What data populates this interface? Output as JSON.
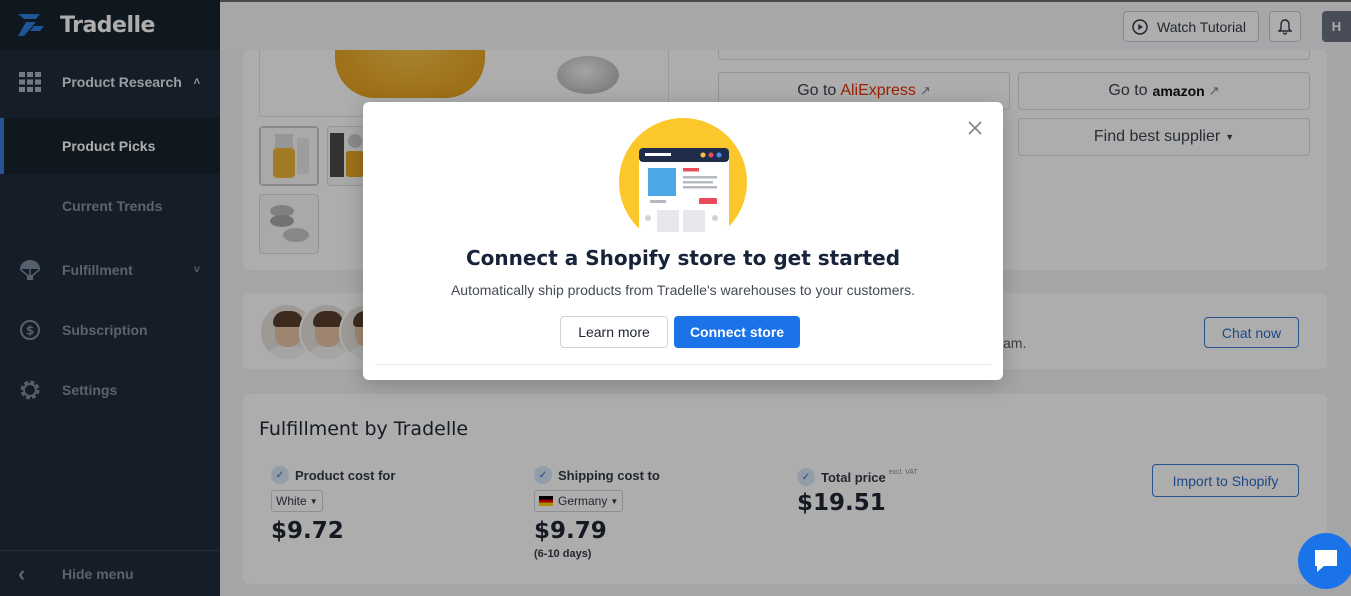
{
  "app": {
    "name": "Tradelle"
  },
  "sidebar": {
    "product_research": "Product Research",
    "product_picks": "Product Picks",
    "current_trends": "Current Trends",
    "fulfillment": "Fulfillment",
    "subscription": "Subscription",
    "settings": "Settings",
    "hide_menu": "Hide menu"
  },
  "header": {
    "watch_tutorial": "Watch Tutorial",
    "avatar_initial": "H"
  },
  "product": {
    "go_to": "Go to",
    "aliexpress": "AliExpress",
    "amazon": "amazon",
    "find_supplier": "Find best supplier"
  },
  "support": {
    "tail_text": "am.",
    "chat_now": "Chat now"
  },
  "fulfillment": {
    "title": "Fulfillment by Tradelle",
    "product_cost_label": "Product cost for",
    "product_variant": "White",
    "product_cost": "$9.72",
    "shipping_cost_label": "Shipping cost to",
    "shipping_country": "Germany",
    "shipping_cost": "$9.79",
    "shipping_days": "(6-10 days)",
    "total_label": "Total price",
    "total_note": "excl. VAT",
    "total_price": "$19.51",
    "import_button": "Import to Shopify"
  },
  "modal": {
    "title": "Connect a Shopify store to get started",
    "subtitle": "Automatically ship products from Tradelle's warehouses to your customers.",
    "learn_more": "Learn more",
    "connect_store": "Connect store"
  },
  "colors": {
    "sidebar_bg": "#1e2b3c",
    "primary": "#1a73e8",
    "illustration_bg": "#fcc72b"
  }
}
